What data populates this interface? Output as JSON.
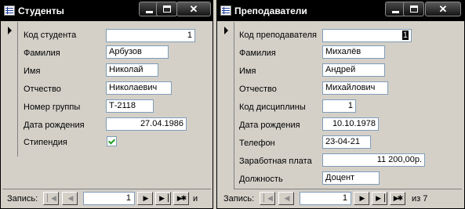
{
  "students": {
    "title": "Студенты",
    "fields": [
      {
        "label": "Код студента",
        "value": "1"
      },
      {
        "label": "Фамилия",
        "value": "Арбузов"
      },
      {
        "label": "Имя",
        "value": "Николай"
      },
      {
        "label": "Отчество",
        "value": "Николаевич"
      },
      {
        "label": "Номер группы",
        "value": "Т-2118"
      },
      {
        "label": "Дата рождения",
        "value": "27.04.1986"
      },
      {
        "label": "Стипендия",
        "checked": true
      }
    ],
    "nav": {
      "label": "Запись:",
      "record": "1",
      "of_text": "и"
    }
  },
  "teachers": {
    "title": "Преподаватели",
    "fields": [
      {
        "label": "Код преподавателя",
        "value": "1"
      },
      {
        "label": "Фамилия",
        "value": "Михалёв"
      },
      {
        "label": "Имя",
        "value": "Андрей"
      },
      {
        "label": "Отчество",
        "value": "Михайлович"
      },
      {
        "label": "Код дисциплины",
        "value": "1"
      },
      {
        "label": "Дата рождения",
        "value": "10.10.1978"
      },
      {
        "label": "Телефон",
        "value": "23-04-21"
      },
      {
        "label": "Заработная плата",
        "value": "11 200,00р."
      },
      {
        "label": "Должность",
        "value": "Доцент"
      }
    ],
    "nav": {
      "label": "Запись:",
      "record": "1",
      "of_text": "из  7"
    }
  },
  "nav_icons": [
    "first-record-icon",
    "prev-record-icon",
    "next-record-icon",
    "last-record-icon",
    "new-record-icon"
  ],
  "window_icons": [
    "form-icon",
    "minimize-icon",
    "maximize-icon",
    "close-icon"
  ],
  "colors": {
    "titlebar": "#000000",
    "window_face": "#d4d0c8",
    "field_border": "#7f9db9",
    "check": "#21a121"
  }
}
